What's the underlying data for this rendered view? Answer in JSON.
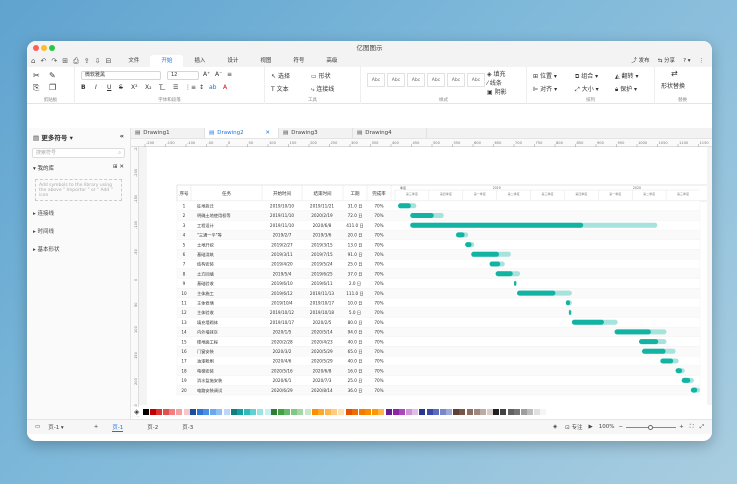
{
  "window": {
    "title": "亿图图示"
  },
  "quick_access": [
    "⌂",
    "↶",
    "↷",
    "⊞",
    "⎙",
    "⇪",
    "⇩",
    "⊟"
  ],
  "menu": {
    "items": [
      "文件",
      "开始",
      "插入",
      "设计",
      "视图",
      "符号",
      "高级"
    ],
    "active": "开始",
    "publish": "发布",
    "share": "分享",
    "help": "?"
  },
  "ribbon": {
    "clipboard_label": "剪贴板",
    "font": {
      "family": "微软雅黑",
      "size": "12",
      "label": "字体和段落"
    },
    "tools": {
      "select": "选择",
      "shape": "形状",
      "text": "文本",
      "connector": "连接线",
      "label": "工具"
    },
    "styles": {
      "samples": [
        "Abc",
        "Abc",
        "Abc",
        "Abc",
        "Abc",
        "Abc"
      ],
      "fill": "填充",
      "line": "线条",
      "shadow": "阴影",
      "label": "样式"
    },
    "arrange": {
      "position": "位置",
      "group": "组合",
      "rotate": "翻转",
      "align": "对齐",
      "size": "大小",
      "protect": "保护",
      "label": "排列"
    },
    "replace": {
      "shape_replace": "形状替换",
      "label": "替换"
    }
  },
  "tabs": [
    {
      "name": "Drawing1",
      "active": false
    },
    {
      "name": "Drawing2",
      "active": true
    },
    {
      "name": "Drawing3",
      "active": false
    },
    {
      "name": "Drawing4",
      "active": false
    }
  ],
  "sidebar": {
    "title": "更多符号",
    "search_placeholder": "搜索符号",
    "mylib": "我的库",
    "drop_hint": "Add symbols to the library using the above \" Importor \" or \" Add \" icon",
    "items": [
      "连接线",
      "时间线",
      "基本形状"
    ]
  },
  "ruler": {
    "h": [
      "-200",
      "-150",
      "-100",
      "-50",
      "0",
      "50",
      "100",
      "150",
      "200",
      "250",
      "300",
      "350",
      "400",
      "450",
      "500",
      "550",
      "600",
      "650",
      "700",
      "750",
      "800",
      "850",
      "900",
      "950",
      "1000",
      "1050",
      "1100",
      "1150"
    ],
    "v": [
      "-250",
      "-200",
      "-150",
      "-100",
      "-50",
      "0",
      "50",
      "100",
      "150",
      "200",
      "250"
    ]
  },
  "gantt": {
    "headers": [
      "序号",
      "任务",
      "开始时间",
      "结束时间",
      "工期",
      "完成率"
    ],
    "timeline": {
      "years": [
        "2019",
        "2020"
      ],
      "pre": "季度",
      "quarters": [
        "第三季度",
        "第四季度",
        "第一季度",
        "第二季度",
        "第三季度",
        "第四季度",
        "第一季度",
        "第二季度",
        "第三季度"
      ]
    },
    "rows": [
      {
        "n": "1",
        "task": "征地拆迁",
        "start": "2019/10/10",
        "end": "2019/11/21",
        "dur": "31.0 日",
        "pct": "70%"
      },
      {
        "n": "2",
        "task": "明确土地使用权等",
        "start": "2019/11/10",
        "end": "2020/2/19",
        "dur": "72.0 日",
        "pct": "70%"
      },
      {
        "n": "3",
        "task": "工程设计",
        "start": "2019/11/10",
        "end": "2020/6/8",
        "dur": "411.0 日",
        "pct": "70%"
      },
      {
        "n": "4",
        "task": "\"三通一平\"等",
        "start": "2019/2/7",
        "end": "2019/3/6",
        "dur": "20.0 日",
        "pct": "70%"
      },
      {
        "n": "5",
        "task": "土地开挖",
        "start": "2019/2/27",
        "end": "2019/3/15",
        "dur": "13.0 日",
        "pct": "70%"
      },
      {
        "n": "6",
        "task": "基础浇筑",
        "start": "2019/3/11",
        "end": "2019/7/15",
        "dur": "91.0 日",
        "pct": "70%"
      },
      {
        "n": "7",
        "task": "结构安装",
        "start": "2019/4/20",
        "end": "2019/5/24",
        "dur": "25.0 日",
        "pct": "70%"
      },
      {
        "n": "8",
        "task": "土方回填",
        "start": "2019/5/4",
        "end": "2019/6/25",
        "dur": "37.0 日",
        "pct": "70%"
      },
      {
        "n": "9",
        "task": "基础验收",
        "start": "2019/6/10",
        "end": "2019/6/11",
        "dur": "2.0 日",
        "pct": "70%"
      },
      {
        "n": "10",
        "task": "主体施工",
        "start": "2019/6/12",
        "end": "2019/11/13",
        "dur": "111.0 日",
        "pct": "70%"
      },
      {
        "n": "11",
        "task": "主体修缮",
        "start": "2019/10/4",
        "end": "2019/10/17",
        "dur": "10.0 日",
        "pct": "70%"
      },
      {
        "n": "12",
        "task": "主体验收",
        "start": "2019/10/12",
        "end": "2019/10/18",
        "dur": "5.0 日",
        "pct": "70%"
      },
      {
        "n": "13",
        "task": "填充墙砌体",
        "start": "2019/10/17",
        "end": "2020/2/5",
        "dur": "80.0 日",
        "pct": "70%"
      },
      {
        "n": "14",
        "task": "内外墙抹灰",
        "start": "2020/1/5",
        "end": "2020/5/14",
        "dur": "94.0 日",
        "pct": "70%"
      },
      {
        "n": "15",
        "task": "楼地面工程",
        "start": "2020/2/28",
        "end": "2020/4/23",
        "dur": "40.0 日",
        "pct": "70%"
      },
      {
        "n": "16",
        "task": "门窗安装",
        "start": "2020/3/2",
        "end": "2020/5/29",
        "dur": "65.0 日",
        "pct": "70%"
      },
      {
        "n": "17",
        "task": "油漆粉刷",
        "start": "2020/4/6",
        "end": "2020/5/29",
        "dur": "40.0 日",
        "pct": "70%"
      },
      {
        "n": "18",
        "task": "电梯安装",
        "start": "2020/5/16",
        "end": "2020/6/8",
        "dur": "16.0 日",
        "pct": "70%"
      },
      {
        "n": "19",
        "task": "消水监施安装",
        "start": "2020/6/1",
        "end": "2020/7/3",
        "dur": "25.0 日",
        "pct": "70%"
      },
      {
        "n": "20",
        "task": "电路安装调试",
        "start": "2020/6/29",
        "end": "2020/8/14",
        "dur": "36.0 日",
        "pct": "70%"
      }
    ]
  },
  "bars": [
    [
      0.01,
      0.07
    ],
    [
      0.05,
      0.16
    ],
    [
      0.05,
      0.86
    ],
    [
      0.2,
      0.24
    ],
    [
      0.23,
      0.26
    ],
    [
      0.25,
      0.38
    ],
    [
      0.31,
      0.36
    ],
    [
      0.33,
      0.41
    ],
    [
      0.39,
      0.4
    ],
    [
      0.4,
      0.58
    ],
    [
      0.56,
      0.58
    ],
    [
      0.57,
      0.58
    ],
    [
      0.58,
      0.73
    ],
    [
      0.72,
      0.89
    ],
    [
      0.8,
      0.89
    ],
    [
      0.81,
      0.92
    ],
    [
      0.87,
      0.93
    ],
    [
      0.92,
      0.95
    ],
    [
      0.94,
      0.98
    ],
    [
      0.97,
      1.0
    ]
  ],
  "colors": {
    "accent": "#1a73e8",
    "bar": "#12b3a3",
    "bar_light": "#a6e3dc"
  },
  "palette": [
    "#000000",
    "#c00000",
    "#e03030",
    "#e05050",
    "#f08080",
    "#f4a0a0",
    "#f8c8c8",
    "#1a4fa0",
    "#2e75d8",
    "#4a90e2",
    "#6aa8f0",
    "#90c0f4",
    "#bcd8f8",
    "#0f7f7f",
    "#14a0a0",
    "#2cbcbc",
    "#60d0d0",
    "#9ce4e4",
    "#c8f0f0",
    "#2e7d32",
    "#43a047",
    "#66bb6a",
    "#81c784",
    "#a5d6a7",
    "#c8e6c9",
    "#ff8f00",
    "#ffa726",
    "#ffb74d",
    "#ffcc80",
    "#ffe0b2",
    "#e65100",
    "#ef6c00",
    "#f57c00",
    "#fb8c00",
    "#ff9800",
    "#ffb74d",
    "#6a1b9a",
    "#8e24aa",
    "#ab47bc",
    "#ce93d8",
    "#e1bee7",
    "#283593",
    "#3949ab",
    "#5c6bc0",
    "#7986cb",
    "#9fa8da",
    "#5d4037",
    "#795548",
    "#8d6e63",
    "#a1887f",
    "#bcaaa4",
    "#d7ccc8",
    "#212121",
    "#424242",
    "#616161",
    "#757575",
    "#9e9e9e",
    "#bdbdbd",
    "#e0e0e0",
    "#f5f5f5"
  ],
  "status": {
    "pages": [
      "页-1",
      "页-1",
      "页-2",
      "页-3"
    ],
    "focus": "专注",
    "zoom": "100%"
  }
}
